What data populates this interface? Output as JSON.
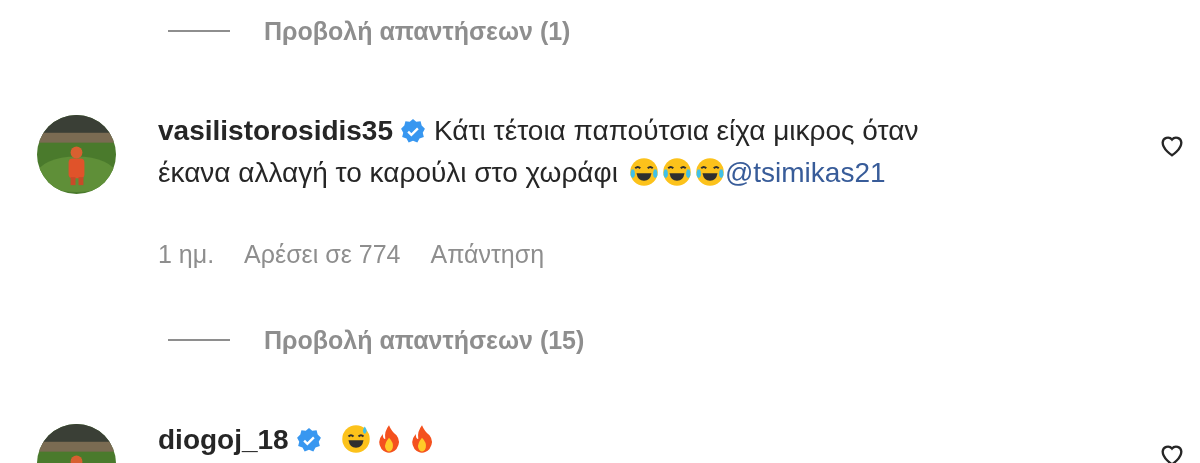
{
  "items": [
    {
      "kind": "replies",
      "label": "Προβολή απαντήσεων (1)"
    },
    {
      "kind": "comment",
      "avatar": {
        "kind": "picture"
      },
      "username": "vasilistorosidis35",
      "verified": true,
      "text_lines": [
        "Κάτι τέτοια παπούτσια είχα μικρος όταν",
        "έκανα αλλαγή το καρούλι στο χωράφι"
      ],
      "emojis": [
        {
          "kind": "tears-of-joy"
        },
        {
          "kind": "tears-of-joy"
        },
        {
          "kind": "tears-of-joy"
        }
      ],
      "mention": "@tsimikas21",
      "time": "1 ημ.",
      "likes": "Αρέσει σε 774",
      "reply": "Απάντηση",
      "liked": false
    },
    {
      "kind": "replies",
      "label": "Προβολή απαντήσεων (15)"
    },
    {
      "kind": "comment",
      "avatar": {
        "kind": "picture"
      },
      "username": "diogoj_18",
      "verified": true,
      "emojis": [
        {
          "kind": "sweat-smile"
        },
        {
          "kind": "fire"
        },
        {
          "kind": "fire"
        }
      ],
      "liked": false
    }
  ]
}
